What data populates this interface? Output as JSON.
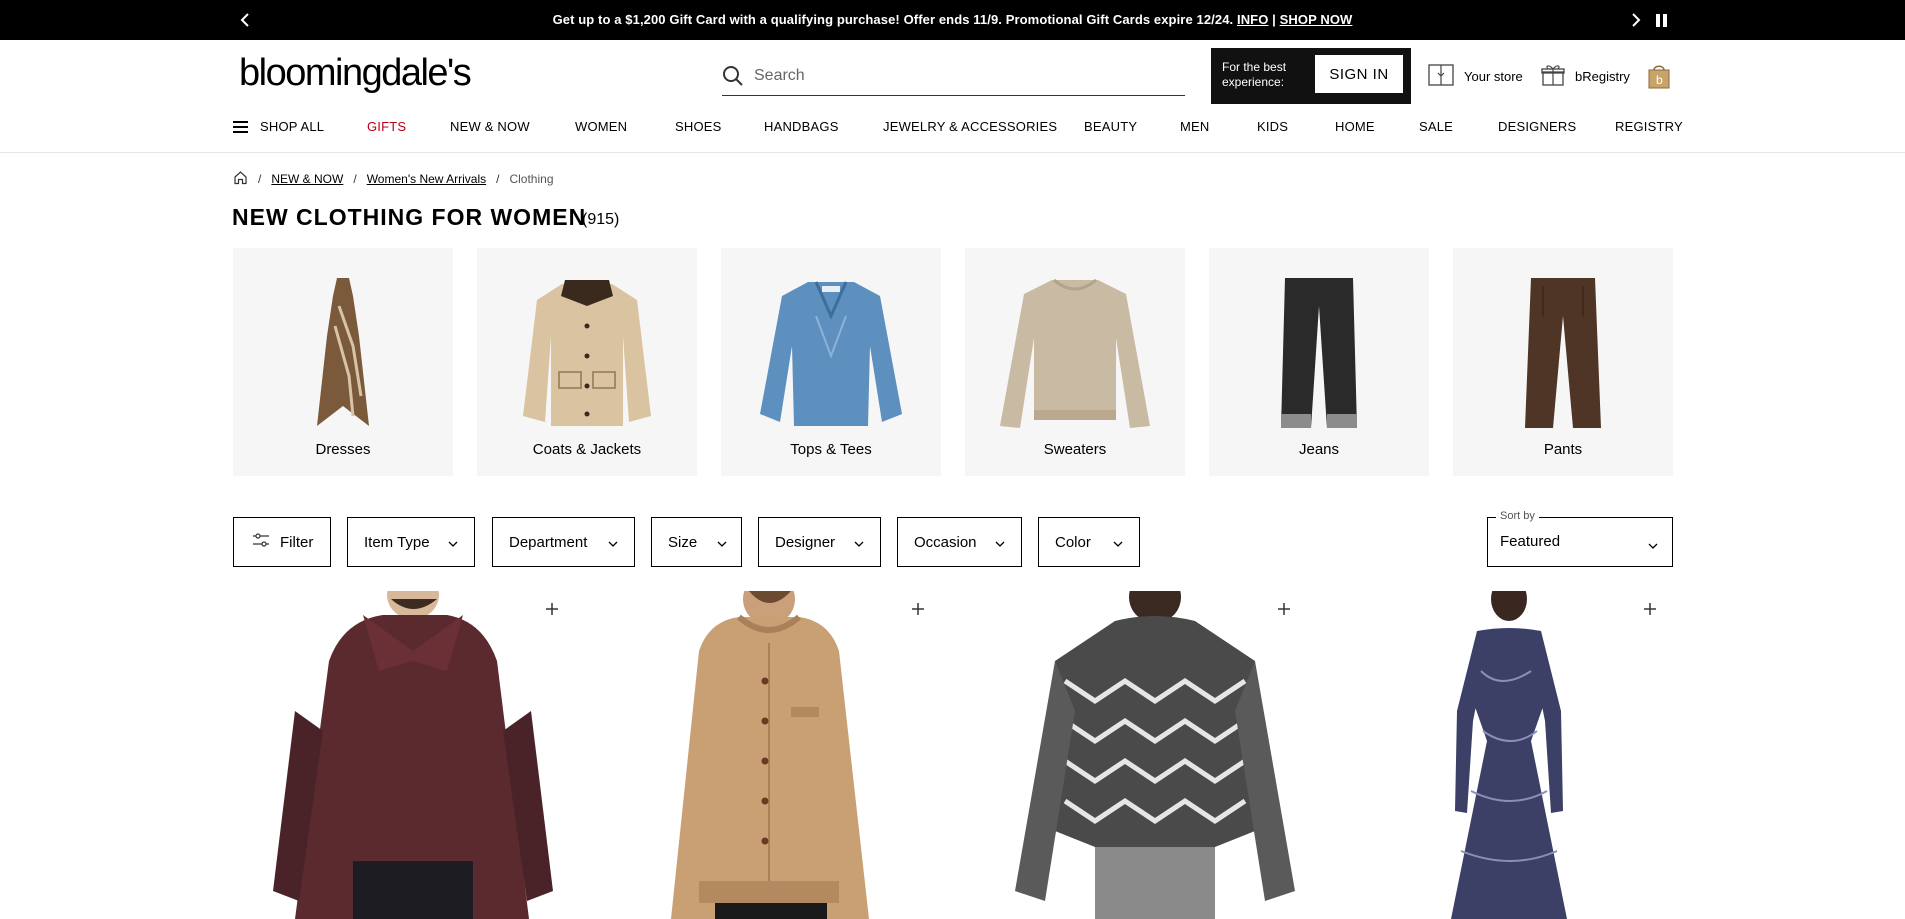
{
  "promo": {
    "text": "Get up to a $1,200 Gift Card with a qualifying purchase! Offer ends 11/9. Promotional Gift Cards expire 12/24.",
    "info_link": "INFO",
    "separator": "|",
    "shop_link": "SHOP NOW",
    "prev_icon": "chevron-left-icon",
    "next_icon": "chevron-right-icon",
    "pause_icon": "pause-icon"
  },
  "header": {
    "logo_text": "bloomingdale's",
    "search": {
      "placeholder": "Search"
    },
    "signin": {
      "caption": "For the best experience:",
      "button": "SIGN IN"
    },
    "store_label": "Your store",
    "registry_label": "bRegistry",
    "bag_icon": "shopping-bag-icon"
  },
  "nav": {
    "shop_all": "SHOP ALL",
    "items": [
      "GIFTS",
      "NEW & NOW",
      "WOMEN",
      "SHOES",
      "HANDBAGS",
      "JEWELRY & ACCESSORIES",
      "BEAUTY",
      "MEN",
      "KIDS",
      "HOME",
      "SALE",
      "DESIGNERS",
      "REGISTRY"
    ],
    "accent_color": "#b8001f"
  },
  "breadcrumb": {
    "home_icon": "home-icon",
    "items": [
      "NEW & NOW",
      "Women's New Arrivals"
    ],
    "current": "Clothing"
  },
  "page": {
    "title": "NEW CLOTHING FOR WOMEN",
    "count": "(915)"
  },
  "categories": [
    {
      "label": "Dresses"
    },
    {
      "label": "Coats & Jackets"
    },
    {
      "label": "Tops & Tees"
    },
    {
      "label": "Sweaters"
    },
    {
      "label": "Jeans"
    },
    {
      "label": "Pants"
    }
  ],
  "filters": {
    "filter_label": "Filter",
    "dropdowns": [
      "Item Type",
      "Department",
      "Size",
      "Designer",
      "Occasion",
      "Color"
    ],
    "sort_legend": "Sort by",
    "sort_value": "Featured"
  },
  "products": [
    {
      "description_icon": "faux-fur-vest-image",
      "add_icon": "plus-icon"
    },
    {
      "description_icon": "camel-cardigan-image",
      "add_icon": "plus-icon"
    },
    {
      "description_icon": "zigzag-sweater-image",
      "add_icon": "plus-icon"
    },
    {
      "description_icon": "navy-print-dress-image",
      "add_icon": "plus-icon"
    }
  ]
}
